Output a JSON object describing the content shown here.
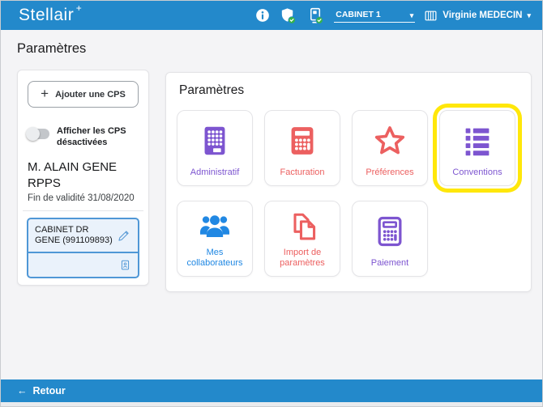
{
  "header": {
    "app_name": "Stellair",
    "cabinet_select": {
      "value": "CABINET 1"
    },
    "user_menu": {
      "name": "Virginie MEDECIN"
    }
  },
  "icons": {
    "sparkle": "+",
    "caret": "▾",
    "plus": "+",
    "back_arrow": "←"
  },
  "page_title": "Paramètres",
  "sidebar": {
    "add_cps_button": "Ajouter une CPS",
    "show_disabled_toggle": {
      "label": "Afficher les CPS désactivées",
      "state": "off"
    },
    "card_holder": "M. ALAIN GENE RPPS",
    "validity": "Fin de validité 31/08/2020",
    "cabinet_entry": "CABINET DR GENE (991109893)"
  },
  "panel": {
    "title": "Paramètres",
    "tiles": [
      {
        "label": "Administratif",
        "color": "#7d55d0",
        "icon": "building-icon",
        "highlighted": false
      },
      {
        "label": "Facturation",
        "color": "#ec6060",
        "icon": "calculator-filled-icon",
        "highlighted": false
      },
      {
        "label": "Préférences",
        "color": "#ec6060",
        "icon": "star-icon",
        "highlighted": false
      },
      {
        "label": "Conventions",
        "color": "#7d55d0",
        "icon": "list-icon",
        "highlighted": true,
        "highlight_color": "#ffe70a"
      },
      {
        "label": "Mes collaborateurs",
        "color": "#2188e3",
        "icon": "people-icon",
        "highlighted": false
      },
      {
        "label": "Import de paramètres",
        "color": "#ec6060",
        "icon": "copy-pages-icon",
        "highlighted": false
      },
      {
        "label": "Paiement",
        "color": "#7d55d0",
        "icon": "calculator-outline-icon",
        "highlighted": false
      }
    ]
  },
  "footer": {
    "back_label": "Retour"
  },
  "colors": {
    "header_blue": "#2389cb",
    "accent_purple": "#7d55d0",
    "accent_red": "#ec6060",
    "accent_blue": "#2188e3",
    "highlight_yellow": "#ffe70a",
    "cps_box_border": "#4f97d6",
    "badge_green": "#35b34a"
  }
}
